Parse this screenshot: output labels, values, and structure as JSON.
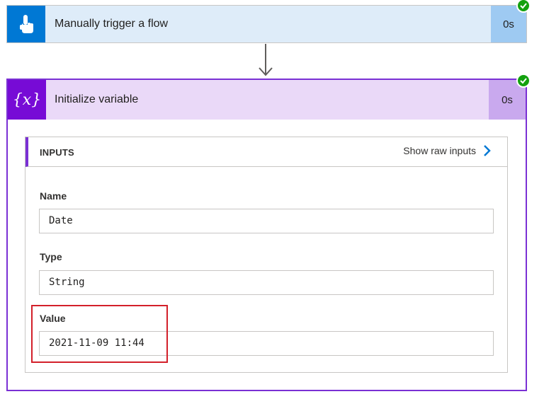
{
  "trigger": {
    "title": "Manually trigger a flow",
    "duration": "0s",
    "icon": "hand-pointer-icon",
    "status": "succeeded",
    "colors": {
      "tile": "#0078d4",
      "body": "#deecf9",
      "duration_bg": "#9ecaf2"
    }
  },
  "action": {
    "title": "Initialize variable",
    "duration": "0s",
    "icon": "variable-braces-icon",
    "status": "succeeded",
    "colors": {
      "tile": "#770bd6",
      "body": "#ead9f8",
      "duration_bg": "#c9a9ee",
      "border": "#7a30d4"
    },
    "inputs": {
      "header": "INPUTS",
      "show_raw_label": "Show raw inputs",
      "fields": [
        {
          "label": "Name",
          "value": "Date"
        },
        {
          "label": "Type",
          "value": "String"
        },
        {
          "label": "Value",
          "value": "2021-11-09 11:44"
        }
      ]
    }
  },
  "annotation": {
    "color": "#d3202a"
  },
  "status_color": "#13a10e"
}
